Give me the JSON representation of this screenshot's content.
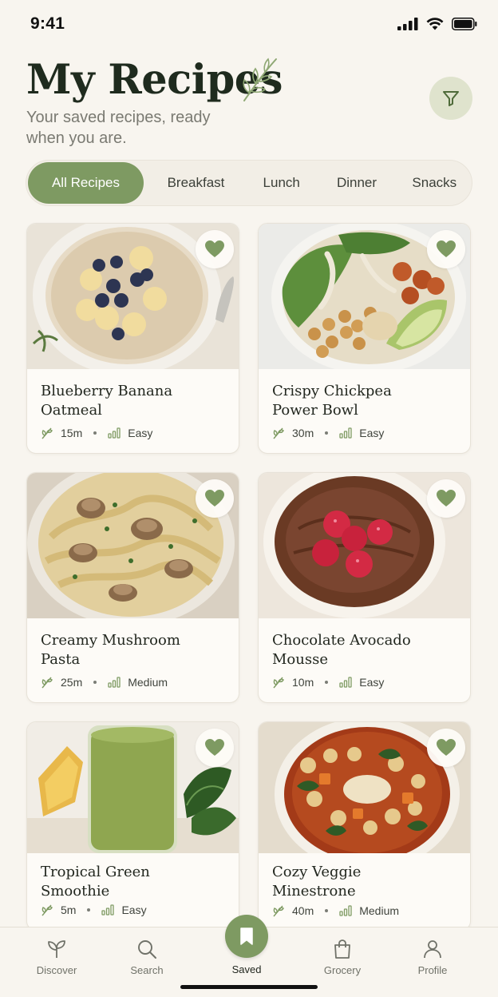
{
  "status": {
    "time": "9:41"
  },
  "header": {
    "title": "My Recipes",
    "subtitle": "Your saved recipes, ready when you are."
  },
  "categories": [
    {
      "label": "All Recipes",
      "active": true
    },
    {
      "label": "Breakfast",
      "active": false
    },
    {
      "label": "Lunch",
      "active": false
    },
    {
      "label": "Dinner",
      "active": false
    },
    {
      "label": "Snacks",
      "active": false
    }
  ],
  "recipes": [
    {
      "title": "Blueberry Banana Oatmeal",
      "time": "15m",
      "difficulty": "Easy",
      "favorited": true,
      "image": "oatmeal-bowl"
    },
    {
      "title": "Crispy Chickpea Power Bowl",
      "time": "30m",
      "difficulty": "Easy",
      "favorited": true,
      "image": "chickpea-bowl"
    },
    {
      "title": "Creamy Mushroom Pasta",
      "time": "25m",
      "difficulty": "Medium",
      "favorited": true,
      "image": "mushroom-pasta"
    },
    {
      "title": "Chocolate Avocado Mousse",
      "time": "10m",
      "difficulty": "Easy",
      "favorited": true,
      "image": "chocolate-mousse"
    },
    {
      "title": "Tropical Green Smoothie",
      "time": "5m",
      "difficulty": "Easy",
      "favorited": true,
      "image": "green-smoothie"
    },
    {
      "title": "Cozy Veggie Minestrone",
      "time": "40m",
      "difficulty": "Medium",
      "favorited": true,
      "image": "minestrone-soup"
    }
  ],
  "nav": {
    "discover": "Discover",
    "search": "Search",
    "saved": "Saved",
    "grocery": "Grocery",
    "profile": "Profile",
    "active": "saved"
  },
  "colors": {
    "accent": "#7e9a62",
    "background": "#f8f5ef",
    "card": "#fdfbf7",
    "title": "#1f2b1e",
    "muted": "#7a7a72"
  }
}
